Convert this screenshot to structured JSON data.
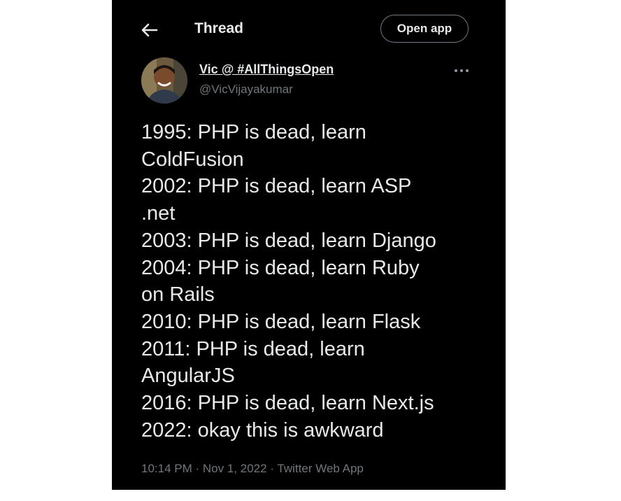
{
  "header": {
    "title": "Thread",
    "open_app_label": "Open app",
    "back_icon": "back-arrow-icon"
  },
  "author": {
    "display_name": "Vic @ #AllThingsOpen",
    "handle": "@VicVijayakumar",
    "avatar_icon": "avatar"
  },
  "tweet": {
    "text": "1995: PHP is dead, learn\nColdFusion\n2002: PHP is dead, learn ASP\n.net\n2003: PHP is dead, learn Django\n2004: PHP is dead, learn Ruby\non Rails\n2010: PHP is dead, learn Flask\n2011: PHP is dead, learn\nAngularJS\n2016: PHP is dead, learn Next.js\n2022: okay this is awkward",
    "time": "10:14 PM",
    "date": "Nov 1, 2022",
    "source": "Twitter Web App",
    "separator": "·"
  },
  "colors": {
    "background": "#000000",
    "primary_text": "#e7e9ea",
    "secondary_text": "#71767b",
    "button_border": "#6f7a82"
  }
}
